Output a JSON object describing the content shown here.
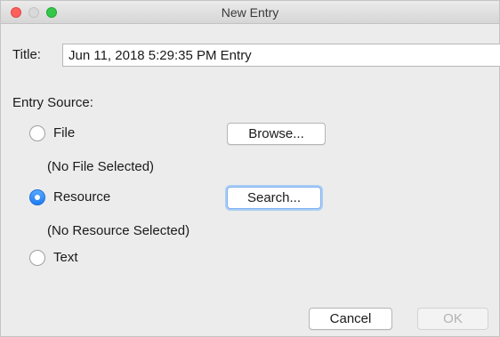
{
  "window": {
    "title": "New Entry"
  },
  "title_field": {
    "label": "Title:",
    "value": "Jun 11, 2018 5:29:35 PM Entry"
  },
  "entry_source": {
    "label": "Entry Source:",
    "selected": "resource",
    "options": {
      "file": {
        "label": "File",
        "button": "Browse...",
        "status": "(No File Selected)"
      },
      "resource": {
        "label": "Resource",
        "button": "Search...",
        "status": "(No Resource Selected)"
      },
      "text": {
        "label": "Text"
      }
    }
  },
  "footer": {
    "cancel_label": "Cancel",
    "ok_label": "OK",
    "ok_enabled": false
  },
  "colors": {
    "accent": "#1d7cf2",
    "focus_ring": "#aacdf5"
  }
}
